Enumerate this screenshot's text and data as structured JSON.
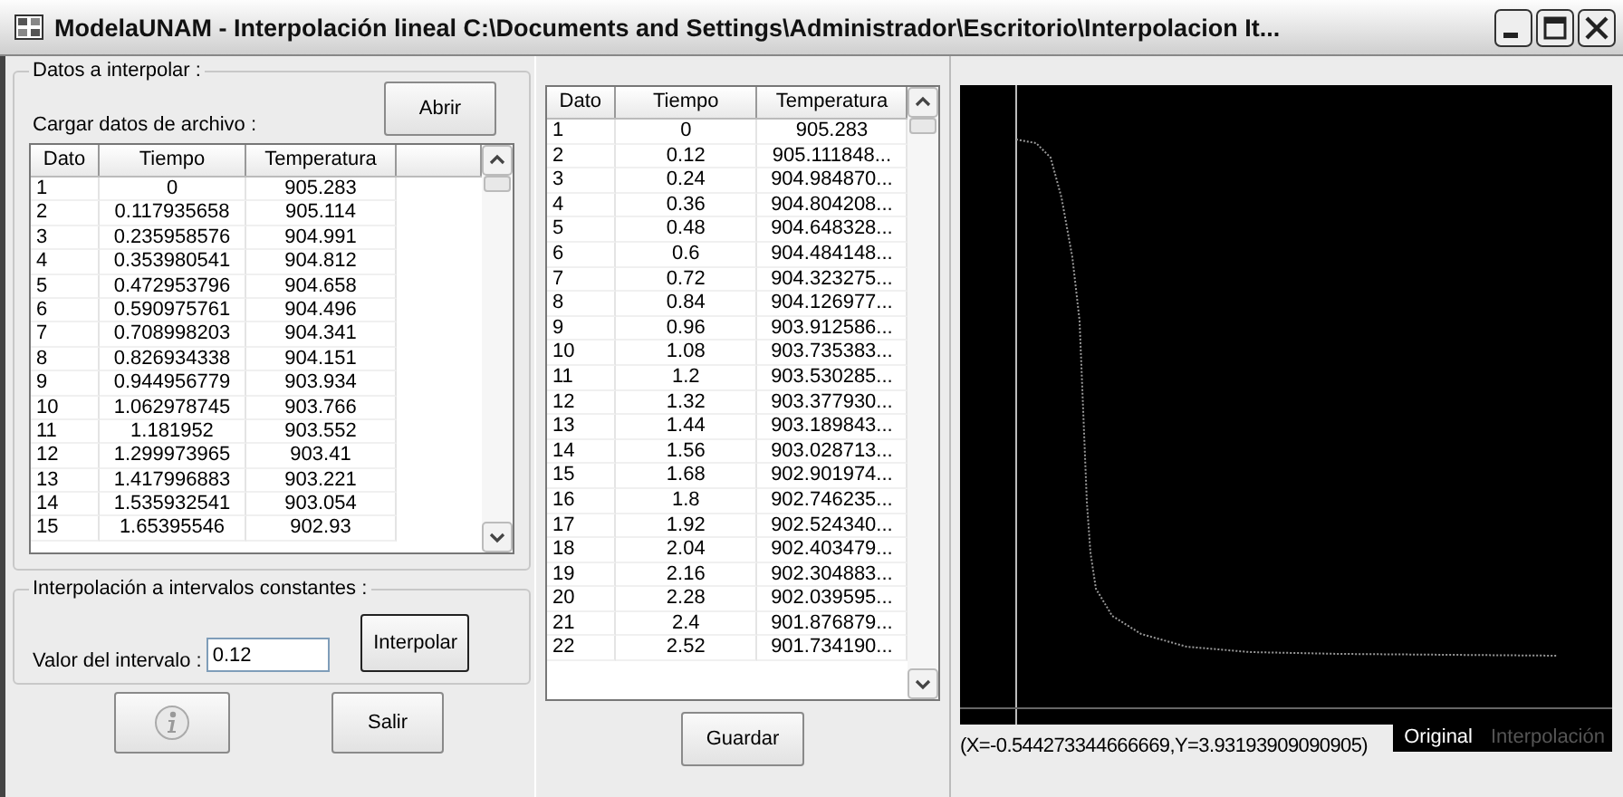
{
  "window": {
    "title": "ModelaUNAM - Interpolación lineal C:\\Documents and Settings\\Administrador\\Escritorio\\Interpolacion It..."
  },
  "input_group": {
    "title": "Datos a interpolar :",
    "load_label": "Cargar datos de archivo :",
    "open_button": "Abrir",
    "table": {
      "columns": [
        "Dato",
        "Tiempo",
        "Temperatura"
      ],
      "rows": [
        [
          "1",
          "0",
          "905.283"
        ],
        [
          "2",
          "0.117935658",
          "905.114"
        ],
        [
          "3",
          "0.235958576",
          "904.991"
        ],
        [
          "4",
          "0.353980541",
          "904.812"
        ],
        [
          "5",
          "0.472953796",
          "904.658"
        ],
        [
          "6",
          "0.590975761",
          "904.496"
        ],
        [
          "7",
          "0.708998203",
          "904.341"
        ],
        [
          "8",
          "0.826934338",
          "904.151"
        ],
        [
          "9",
          "0.944956779",
          "903.934"
        ],
        [
          "10",
          "1.062978745",
          "903.766"
        ],
        [
          "11",
          "1.181952",
          "903.552"
        ],
        [
          "12",
          "1.299973965",
          "903.41"
        ],
        [
          "13",
          "1.417996883",
          "903.221"
        ],
        [
          "14",
          "1.535932541",
          "903.054"
        ],
        [
          "15",
          "1.65395546",
          "902.93"
        ]
      ]
    }
  },
  "interval_group": {
    "title": "Interpolación a intervalos constantes :",
    "label": "Valor del intervalo :",
    "value": "0.12",
    "button": "Interpolar"
  },
  "exit_button": "Salir",
  "result_table": {
    "columns": [
      "Dato",
      "Tiempo",
      "Temperatura"
    ],
    "rows": [
      [
        "1",
        "0",
        "905.283"
      ],
      [
        "2",
        "0.12",
        "905.111848..."
      ],
      [
        "3",
        "0.24",
        "904.984870..."
      ],
      [
        "4",
        "0.36",
        "904.804208..."
      ],
      [
        "5",
        "0.48",
        "904.648328..."
      ],
      [
        "6",
        "0.6",
        "904.484148..."
      ],
      [
        "7",
        "0.72",
        "904.323275..."
      ],
      [
        "8",
        "0.84",
        "904.126977..."
      ],
      [
        "9",
        "0.96",
        "903.912586..."
      ],
      [
        "10",
        "1.08",
        "903.735383..."
      ],
      [
        "11",
        "1.2",
        "903.530285..."
      ],
      [
        "12",
        "1.32",
        "903.377930..."
      ],
      [
        "13",
        "1.44",
        "903.189843..."
      ],
      [
        "14",
        "1.56",
        "903.028713..."
      ],
      [
        "15",
        "1.68",
        "902.901974..."
      ],
      [
        "16",
        "1.8",
        "902.746235..."
      ],
      [
        "17",
        "1.92",
        "902.524340..."
      ],
      [
        "18",
        "2.04",
        "902.403479..."
      ],
      [
        "19",
        "2.16",
        "902.304883..."
      ],
      [
        "20",
        "2.28",
        "902.039595..."
      ],
      [
        "21",
        "2.4",
        "901.876879..."
      ],
      [
        "22",
        "2.52",
        "901.734190..."
      ]
    ]
  },
  "save_button": "Guardar",
  "plot": {
    "coordinates": "(X=-0.544273344666669,Y=3.93193909090905)",
    "legend": [
      {
        "label": "Original",
        "selected": true
      },
      {
        "label": "Interpolación",
        "selected": false
      }
    ]
  }
}
